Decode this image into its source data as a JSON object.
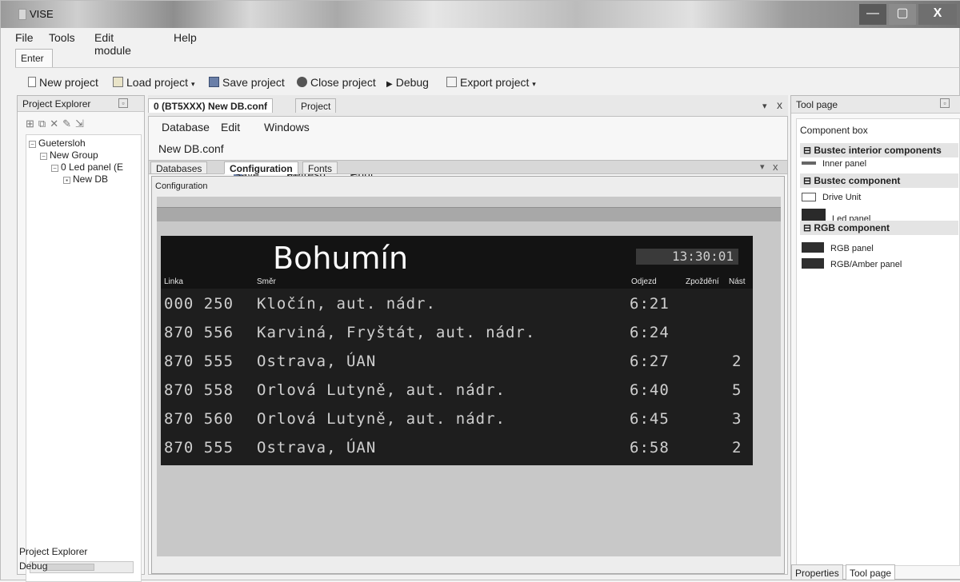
{
  "window": {
    "title": "VISE",
    "minimize": "—",
    "maximize": "▢",
    "close": "X"
  },
  "menu": [
    "File",
    "Tools",
    "Edit module",
    "Help"
  ],
  "ribbon_tab": "Enter",
  "toolbar": {
    "new_project": "New project",
    "load_project": "Load project",
    "save_project": "Save project",
    "close_project": "Close project",
    "debug": "Debug",
    "export_project": "Export project"
  },
  "project_explorer": {
    "title": "Project Explorer",
    "tree": [
      {
        "label": "Guetersloh",
        "level": 0
      },
      {
        "label": "New Group",
        "level": 1
      },
      {
        "label": "0 Led panel (E",
        "level": 2
      },
      {
        "label": "New DB",
        "level": 3
      }
    ],
    "bottom_tabs": [
      "Project Explorer",
      "Debug"
    ]
  },
  "document": {
    "tabs": [
      "0 (BT5XXX) New DB.conf",
      "Project"
    ],
    "close": "x",
    "dropdown": "▾",
    "menu": [
      "Database",
      "Edit",
      "Windows"
    ],
    "toolbar": {
      "file": "New DB.conf",
      "save": "Save",
      "refresh": "Refresh",
      "print": "Print"
    },
    "subtabs": [
      "Databases",
      "Configuration",
      "Fonts"
    ],
    "section_label": "Configuration"
  },
  "board": {
    "city": "Bohumín",
    "clock": "13:30:01",
    "headers": {
      "line": "Linka",
      "direction": "Směr",
      "departure": "Odjezd",
      "delay": "Zpoždění",
      "platform": "Nást"
    },
    "rows": [
      {
        "line": "000 250",
        "direction": "Kločín, aut. nádr.",
        "departure": "6:21",
        "delay": ""
      },
      {
        "line": "870 556",
        "direction": "Karviná, Fryštát, aut. nádr.",
        "departure": "6:24",
        "delay": ""
      },
      {
        "line": "870 555",
        "direction": "Ostrava, ÚAN",
        "departure": "6:27",
        "delay": "2"
      },
      {
        "line": "870 558",
        "direction": "Orlová Lutyně, aut. nádr.",
        "departure": "6:40",
        "delay": "5"
      },
      {
        "line": "870 560",
        "direction": "Orlová Lutyně, aut. nádr.",
        "departure": "6:45",
        "delay": "3"
      },
      {
        "line": "870 555",
        "direction": "Ostrava, ÚAN",
        "departure": "6:58",
        "delay": "2"
      }
    ]
  },
  "tool_page": {
    "title": "Tool page",
    "box_title": "Component box",
    "categories": [
      {
        "name": "Bustec interior components",
        "items": [
          "Inner panel"
        ]
      },
      {
        "name": "Bustec component",
        "items": [
          "Drive Unit",
          "Led panel"
        ]
      },
      {
        "name": "RGB component",
        "items": [
          "RGB panel",
          "RGB/Amber panel"
        ]
      }
    ],
    "bottom_tabs": [
      "Properties",
      "Tool page"
    ]
  },
  "colors": {
    "board_bg": "#1e1e1e",
    "led_text": "#cfcfcf",
    "strip": "#a8a8a8"
  }
}
